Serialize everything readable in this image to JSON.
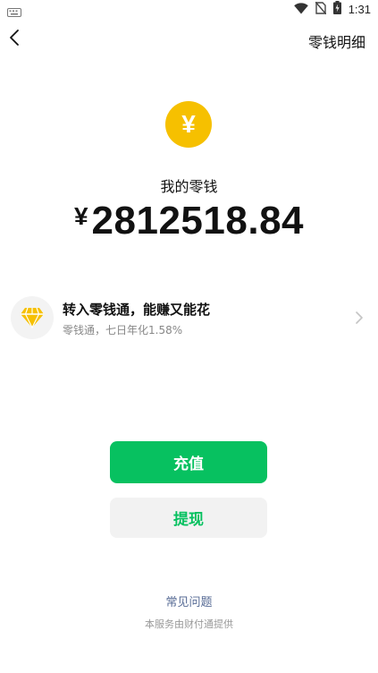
{
  "status_bar": {
    "time": "1:31",
    "icons": [
      "keyboard-icon",
      "wifi-icon",
      "no-sim-icon",
      "battery-charging-icon"
    ]
  },
  "header": {
    "back_icon": "chevron-left-icon",
    "details_link": "零钱明细"
  },
  "balance": {
    "coin_symbol": "¥",
    "label": "我的零钱",
    "currency": "¥",
    "amount": "2812518.84"
  },
  "promo": {
    "icon": "diamond-icon",
    "title": "转入零钱通，能赚又能花",
    "subtitle": "零钱通，七日年化1.58%"
  },
  "actions": {
    "recharge_label": "充值",
    "withdraw_label": "提现"
  },
  "footer": {
    "faq_label": "常见问题",
    "provider_note": "本服务由财付通提供"
  },
  "colors": {
    "accent_green": "#07c160",
    "coin_yellow": "#f6c000",
    "link_blue": "#576b95",
    "secondary_gray": "#888888"
  }
}
